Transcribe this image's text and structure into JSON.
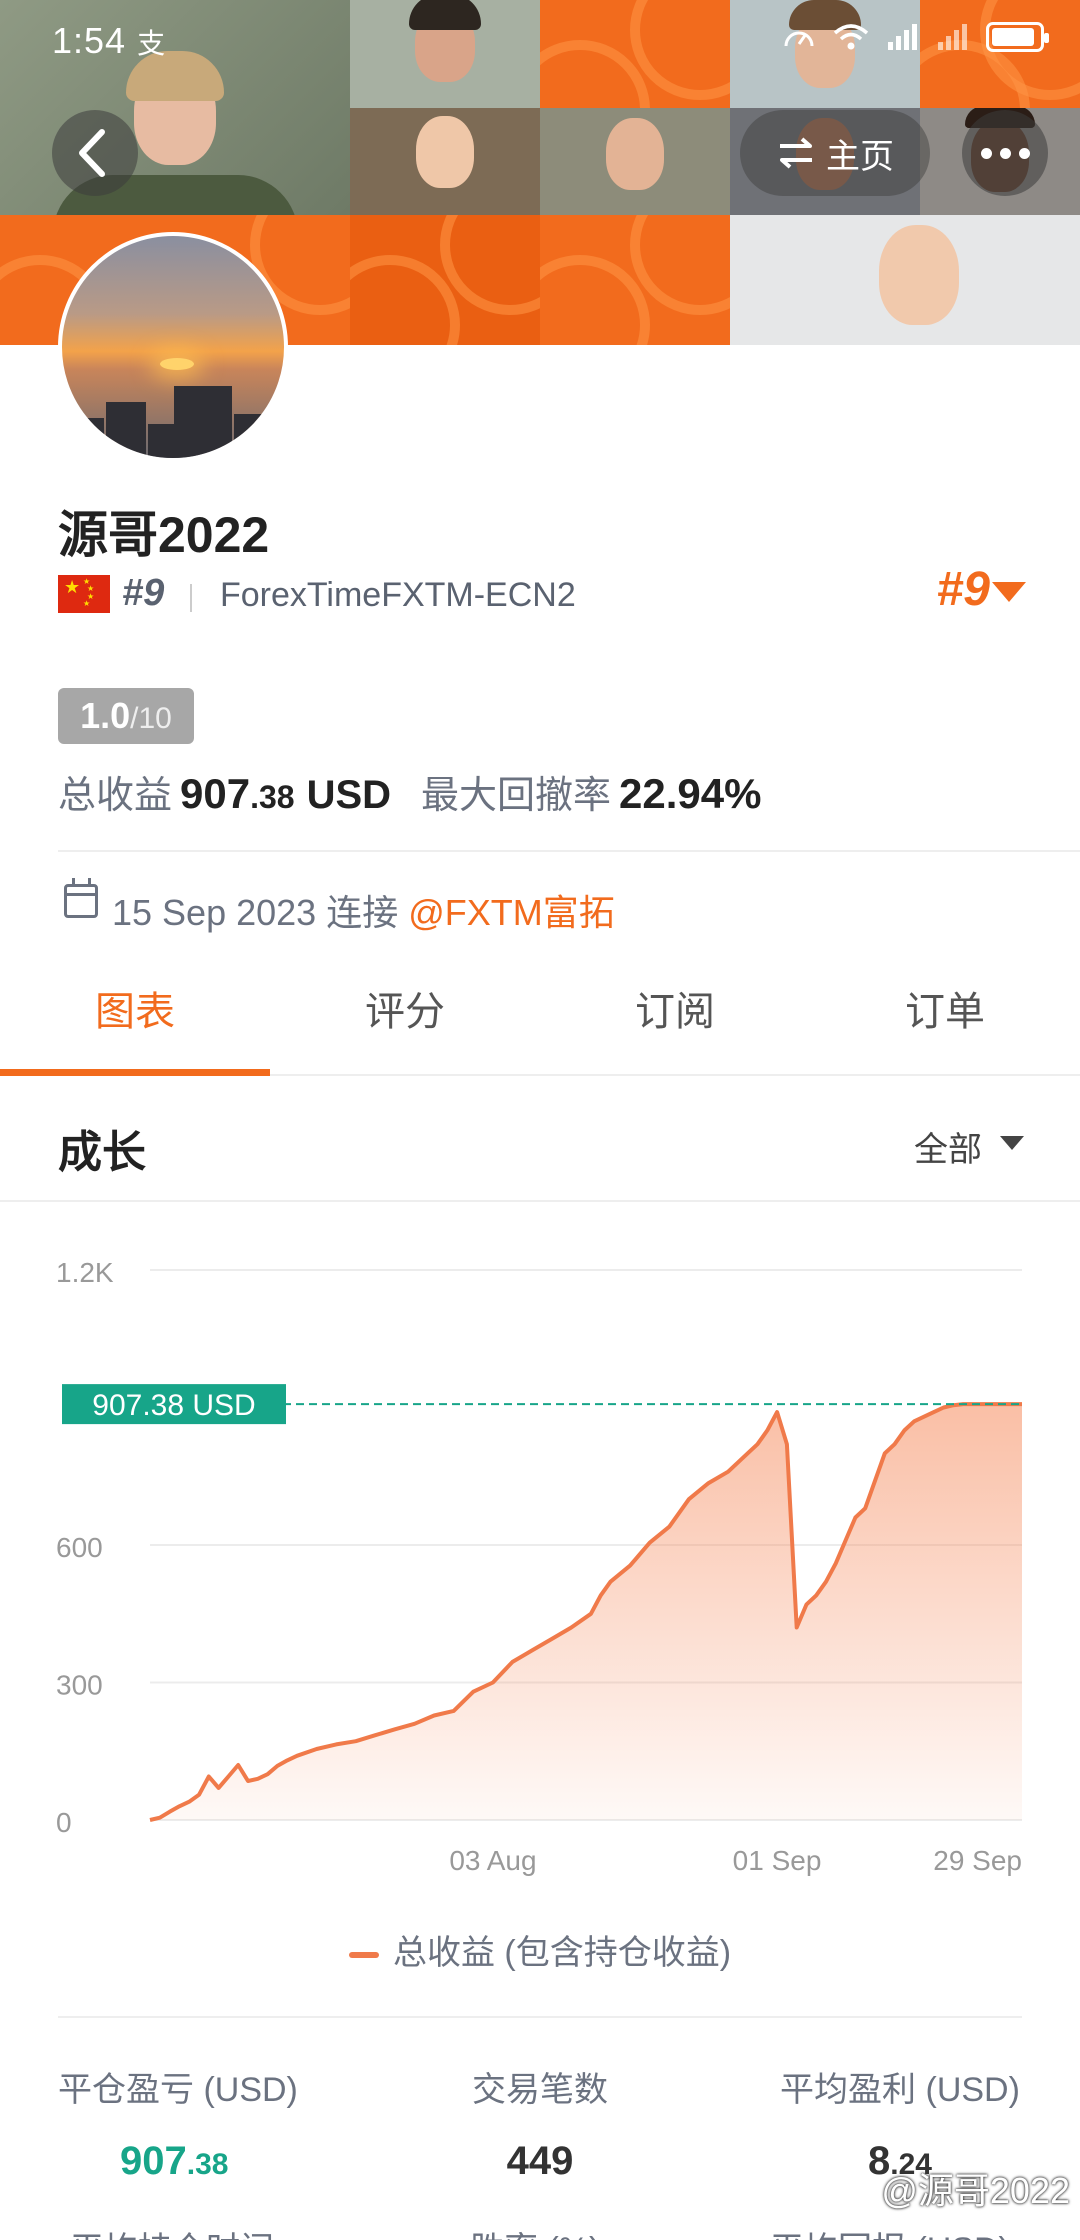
{
  "status_bar": {
    "time": "1:54",
    "notif_glyph": "支"
  },
  "header": {
    "home_label": "主页",
    "icons": [
      "back-arrow-icon",
      "swap-arrows-icon",
      "more-dots-icon"
    ]
  },
  "profile": {
    "name": "源哥2022",
    "rank_small": "#9",
    "broker": "ForexTimeFXTM-ECN2",
    "rank_big": "#9",
    "score_value": "1.0",
    "score_max": "/10",
    "total_profit_label": "总收益",
    "total_profit_int": "907",
    "total_profit_dec": ".38",
    "total_profit_unit": "USD",
    "max_drawdown_label": "最大回撤率",
    "max_drawdown_value": "22.94%",
    "connected_date": "15 Sep 2023",
    "connected_text": "连接",
    "connected_broker": "@FXTM富拓"
  },
  "tabs": [
    "图表",
    "评分",
    "订阅",
    "订单"
  ],
  "section": {
    "title": "成长",
    "filter": "全部"
  },
  "chart_data": {
    "type": "area",
    "ylim": [
      0,
      1200
    ],
    "yticks": [
      "0",
      "300",
      "600",
      "1.2K"
    ],
    "ytick_values": [
      0,
      300,
      600,
      1200
    ],
    "xticks": [
      "03 Aug",
      "01 Sep",
      "29 Sep"
    ],
    "xtick_positions": [
      35,
      64,
      89
    ],
    "xlim": [
      0,
      89
    ],
    "current_label": "907.38 USD",
    "current_value": 907.38,
    "legend": "总收益 (包含持仓收益)",
    "series": [
      {
        "name": "总收益 (包含持仓收益)",
        "x": [
          0,
          1,
          2,
          3,
          4,
          5,
          6,
          7,
          8,
          9,
          10,
          11,
          12,
          13,
          14,
          15,
          17,
          19,
          21,
          23,
          25,
          27,
          29,
          31,
          33,
          35,
          37,
          39,
          41,
          43,
          45,
          46,
          47,
          49,
          51,
          53,
          55,
          57,
          59,
          61,
          62,
          63,
          64,
          65,
          66,
          67,
          68,
          69,
          70,
          71,
          72,
          73,
          74,
          75,
          76,
          77,
          78,
          79,
          80,
          81,
          82,
          83,
          84,
          85,
          86,
          87,
          88,
          89
        ],
        "values": [
          0,
          5,
          18,
          30,
          40,
          55,
          95,
          70,
          95,
          120,
          85,
          90,
          100,
          118,
          130,
          140,
          155,
          165,
          172,
          185,
          198,
          210,
          228,
          238,
          280,
          300,
          345,
          370,
          395,
          420,
          450,
          490,
          520,
          555,
          605,
          640,
          700,
          735,
          760,
          800,
          820,
          850,
          890,
          820,
          420,
          470,
          490,
          520,
          560,
          610,
          660,
          680,
          740,
          800,
          820,
          850,
          870,
          880,
          890,
          900,
          905,
          907.38,
          907.38,
          907.38,
          907.38,
          907.38,
          907.38,
          907.38
        ]
      }
    ]
  },
  "metrics": [
    {
      "label": "平仓盈亏 (USD)",
      "value_int": "907",
      "value_dec": ".38",
      "color": "#17a589"
    },
    {
      "label": "交易笔数",
      "value_int": "449",
      "value_dec": "",
      "color": "#333333"
    },
    {
      "label": "平均盈利 (USD)",
      "value_int": "8",
      "value_dec": ".24",
      "color": "#333333"
    }
  ],
  "metrics_row2": [
    "平均持仓时间",
    "胜率 (%)",
    "平均回报 (USD)"
  ],
  "watermark": "@源哥2022",
  "colors": {
    "accent": "#f26b1d",
    "line": "#f07a4a",
    "marker": "#17a589",
    "muted": "#6b7280"
  }
}
